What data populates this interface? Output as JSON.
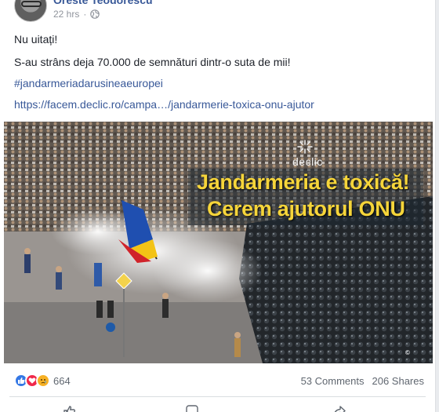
{
  "post": {
    "author": "Oreste Teodorescu",
    "time": "22 hrs",
    "privacy_icon": "globe-icon",
    "lines": [
      "Nu uitați!",
      "S-au strâns deja 70.000 de semnături dintr-o suta de mii!",
      "#jandarmeriadarusineaeuropei",
      "https://facem.declic.ro/campa…/jandarmerie-toxica-onu-ajutor"
    ]
  },
  "image": {
    "banner_line1": "Jandarmeria e toxică!",
    "banner_line2": "Cerem ajutorul ONU",
    "logo": "declic",
    "banner_color": "#f6d53a"
  },
  "footer": {
    "reaction_icons": [
      "like-icon",
      "love-icon",
      "sad-icon"
    ],
    "reaction_count": "664",
    "comments": "53 Comments",
    "shares": "206 Shares"
  },
  "colors": {
    "link": "#385898",
    "text": "#1d2129",
    "meta": "#90949c",
    "like": "#3578e5",
    "love": "#f0284a",
    "sad": "#f7b125"
  }
}
